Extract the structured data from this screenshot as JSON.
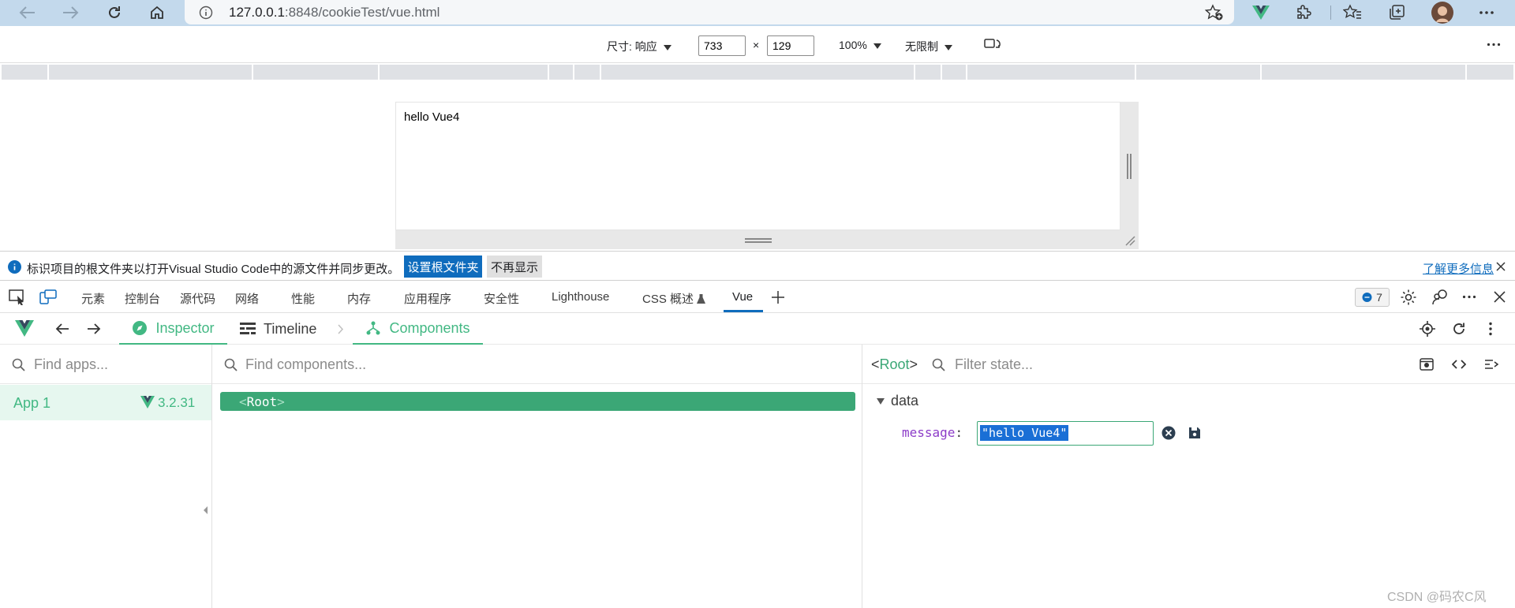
{
  "browser": {
    "url_host": "127.0.0.1",
    "url_rest": ":8848/cookieTest/vue.html"
  },
  "device_toolbar": {
    "size_label": "尺寸: 响应",
    "width": "733",
    "times": "×",
    "height": "129",
    "zoom": "100%",
    "throttle": "无限制"
  },
  "page": {
    "content": "hello Vue4"
  },
  "info_bar": {
    "message": "标识项目的根文件夹以打开Visual Studio Code中的源文件并同步更改。",
    "set_root_button": "设置根文件夹",
    "dont_show_button": "不再显示",
    "learn_more": "了解更多信息"
  },
  "devtools_tabs": {
    "items": [
      "元素",
      "控制台",
      "源代码",
      "网络",
      "性能",
      "内存",
      "应用程序",
      "安全性",
      "Lighthouse",
      "CSS 概述",
      "Vue"
    ],
    "active": "Vue",
    "issues_count": "7"
  },
  "vue_devtools": {
    "tabs": [
      "Inspector",
      "Timeline",
      "Components"
    ],
    "apps_search_placeholder": "Find apps...",
    "components_search_placeholder": "Find components...",
    "state_filter_placeholder": "Filter state...",
    "app": {
      "name": "App 1",
      "version": "3.2.31"
    },
    "root_component": "Root",
    "state": {
      "selected": "Root",
      "section": "data",
      "key": "message",
      "value": "\"hello Vue4\""
    }
  },
  "watermark": "CSDN @码农C风",
  "colors": {
    "vue_green": "#42b883",
    "selected_row": "#3ba776",
    "edge_blue": "#0f6cbd"
  }
}
